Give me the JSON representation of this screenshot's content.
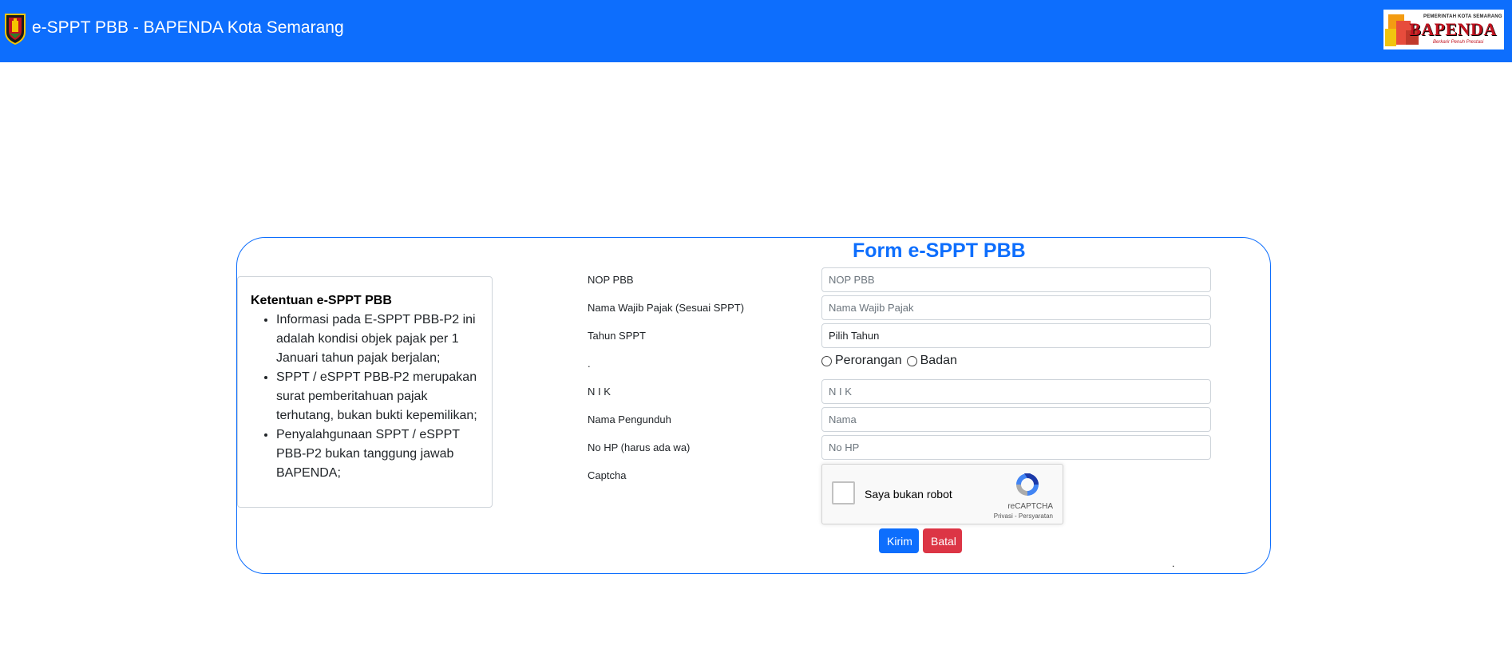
{
  "header": {
    "title": "e-SPPT PBB - BAPENDA Kota Semarang",
    "logo": {
      "top_text": "PEMERINTAH KOTA SEMARANG",
      "main_text": "BAPENDA",
      "tagline": "Berkarir Penuh Prestasi"
    },
    "background_color": "#0d6efd"
  },
  "form": {
    "title": "Form e-SPPT PBB",
    "border_color": "#0d6efd",
    "fields": [
      {
        "label": "NOP PBB",
        "placeholder": "NOP PBB",
        "value": ""
      },
      {
        "label": "Nama Wajib Pajak (Sesuai SPPT)",
        "placeholder": "Nama Wajib Pajak",
        "value": ""
      },
      {
        "label": "Tahun SPPT",
        "selected": "Pilih Tahun"
      },
      {
        "label": "."
      },
      {
        "label": "N I K",
        "placeholder": "N I K",
        "value": ""
      },
      {
        "label": "Nama Pengunduh",
        "placeholder": "Nama",
        "value": ""
      },
      {
        "label": "No HP (harus ada wa)",
        "placeholder": "No HP",
        "value": ""
      },
      {
        "label": "Captcha"
      }
    ],
    "radio_options": [
      "Perorangan",
      "Badan"
    ],
    "captcha": {
      "checkbox_label": "Saya bukan robot",
      "brand": "reCAPTCHA",
      "terms": "Privasi - Persyaratan"
    },
    "submit_label": "Kirim",
    "cancel_label": "Batal",
    "footer_dot": "."
  },
  "info": {
    "title": "Ketentuan e-SPPT PBB",
    "items": [
      "Informasi pada E-SPPT PBB-P2 ini adalah kondisi objek pajak per 1 Januari tahun pajak berjalan;",
      "SPPT / eSPPT PBB-P2 merupakan surat pemberitahuan pajak terhutang, bukan bukti kepemilikan;",
      "Penyalahgunaan SPPT / eSPPT PBB-P2 bukan tanggung jawab BAPENDA;"
    ]
  },
  "colors": {
    "primary": "#0d6efd",
    "danger": "#dc3545"
  }
}
